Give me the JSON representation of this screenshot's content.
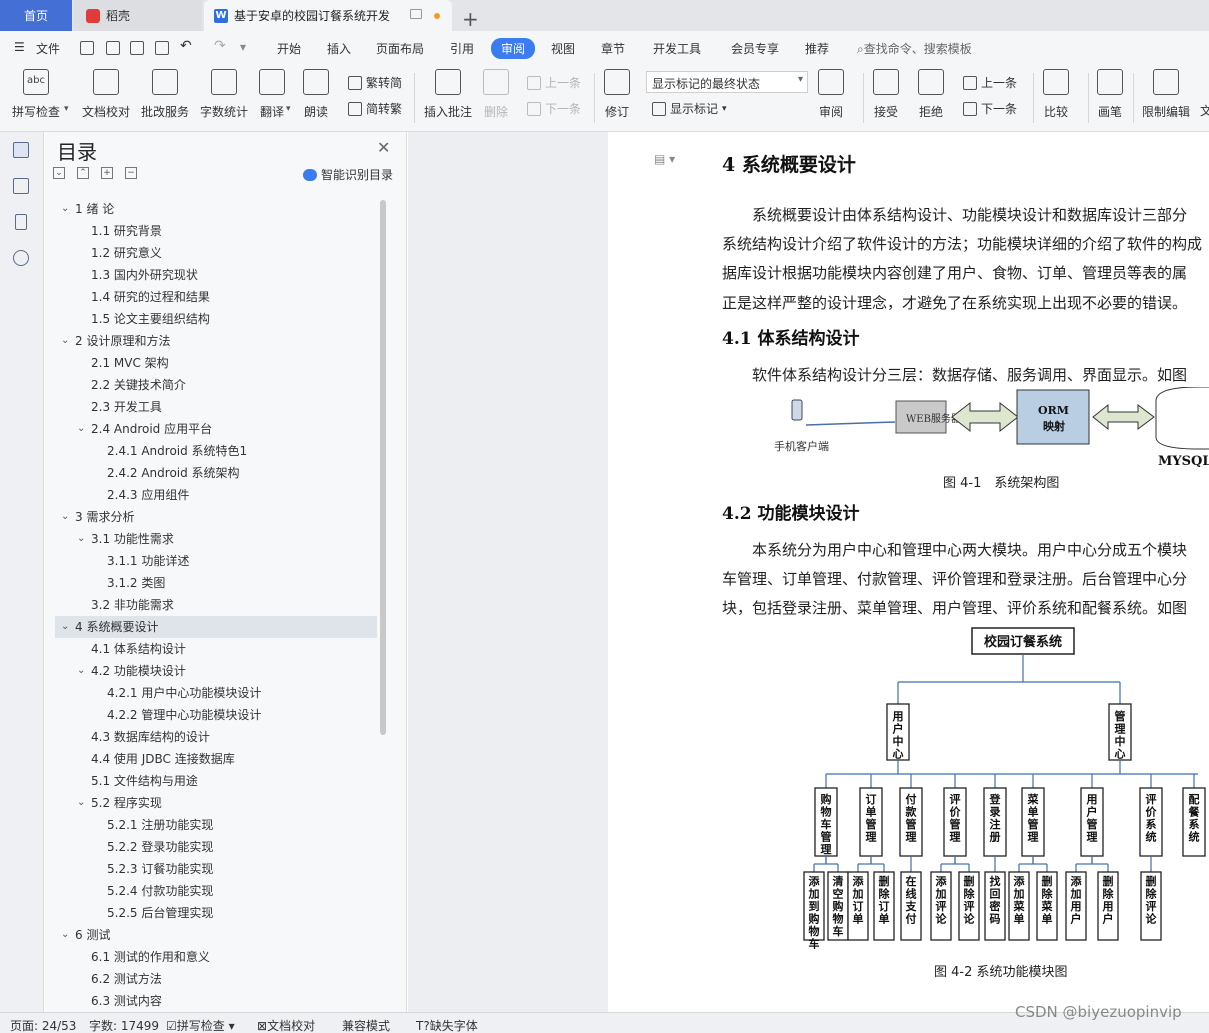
{
  "tabs": {
    "home": "首页",
    "wps": "稻壳",
    "doc": "基于安卓的校园订餐系统开发"
  },
  "menu": {
    "file": "文件",
    "items": [
      "开始",
      "插入",
      "页面布局",
      "引用",
      "审阅",
      "视图",
      "章节",
      "开发工具",
      "会员专享",
      "推荐"
    ],
    "search": "查找命令、搜索模板"
  },
  "ribbon": {
    "spellcheck": "拼写检查",
    "doccheck": "文档校对",
    "batch": "批改服务",
    "wordcount": "字数统计",
    "translate": "翻译",
    "read": "朗读",
    "t2s": "繁转简",
    "s2t": "简转繁",
    "insert_comment": "插入批注",
    "delete": "删除",
    "prev": "上一条",
    "next": "下一条",
    "revise": "修订",
    "state": "显示标记的最终状态",
    "show_marks": "显示标记",
    "review": "审阅",
    "accept": "接受",
    "reject": "拒绝",
    "prev2": "上一条",
    "next2": "下一条",
    "compare": "比较",
    "pen": "画笔",
    "restrict": "限制编辑",
    "doc_char": "文"
  },
  "toc": {
    "title": "目录",
    "smart": "智能识别目录",
    "items": [
      {
        "t": "1  绪  论",
        "l": 1,
        "arrow": "down"
      },
      {
        "t": "1.1  研究背景",
        "l": 2
      },
      {
        "t": "1.2  研究意义",
        "l": 2
      },
      {
        "t": "1.3  国内外研究现状",
        "l": 2
      },
      {
        "t": "1.4  研究的过程和结果",
        "l": 2
      },
      {
        "t": "1.5  论文主要组织结构",
        "l": 2
      },
      {
        "t": "2  设计原理和方法",
        "l": 1,
        "arrow": "down"
      },
      {
        "t": "2.1 MVC 架构",
        "l": 2
      },
      {
        "t": "2.2  关键技术简介",
        "l": 2
      },
      {
        "t": "2.3  开发工具",
        "l": 2
      },
      {
        "t": "2.4 Android 应用平台",
        "l": 2,
        "arrow": "down"
      },
      {
        "t": "2.4.1 Android 系统特色1",
        "l": 3
      },
      {
        "t": "2.4.2 Android 系统架构",
        "l": 3
      },
      {
        "t": "2.4.3  应用组件",
        "l": 3
      },
      {
        "t": "3  需求分析",
        "l": 1,
        "arrow": "down"
      },
      {
        "t": "3.1  功能性需求",
        "l": 2,
        "arrow": "down"
      },
      {
        "t": "3.1.1 功能详述",
        "l": 3
      },
      {
        "t": "3.1.2  类图",
        "l": 3
      },
      {
        "t": "3.2  非功能需求",
        "l": 2
      },
      {
        "t": "4  系统概要设计",
        "l": 1,
        "arrow": "down",
        "sel": true
      },
      {
        "t": "4.1  体系结构设计",
        "l": 2
      },
      {
        "t": "4.2  功能模块设计",
        "l": 2,
        "arrow": "down"
      },
      {
        "t": "4.2.1  用户中心功能模块设计",
        "l": 3
      },
      {
        "t": "4.2.2  管理中心功能模块设计",
        "l": 3
      },
      {
        "t": "4.3  数据库结构的设计",
        "l": 2
      },
      {
        "t": "4.4  使用 JDBC 连接数据库",
        "l": 2
      },
      {
        "t": "5.1 文件结构与用途",
        "l": 2
      },
      {
        "t": "5.2  程序实现",
        "l": 2,
        "arrow": "down"
      },
      {
        "t": "5.2.1  注册功能实现",
        "l": 3
      },
      {
        "t": "5.2.2  登录功能实现",
        "l": 3
      },
      {
        "t": "5.2.3  订餐功能实现",
        "l": 3
      },
      {
        "t": "5.2.4  付款功能实现",
        "l": 3
      },
      {
        "t": "5.2.5  后台管理实现",
        "l": 3
      },
      {
        "t": "6  测试",
        "l": 1,
        "arrow": "down"
      },
      {
        "t": "6.1  测试的作用和意义",
        "l": 2
      },
      {
        "t": "6.2  测试方法",
        "l": 2
      },
      {
        "t": "6.3  测试内容",
        "l": 2
      }
    ]
  },
  "doc": {
    "h4": "4  系统概要设计",
    "p1": [
      "　　系统概要设计由体系结构设计、功能模块设计和数据库设计三部分",
      "系统结构设计介绍了软件设计的方法；功能模块详细的介绍了软件的构成",
      "据库设计根据功能模块内容创建了用户、食物、订单、管理员等表的属",
      "正是这样严整的设计理念，才避免了在系统实现上出现不必要的错误。"
    ],
    "h41": "4.1 体系结构设计",
    "p2": "　　软件体系结构设计分三层：数据存储、服务调用、界面显示。如图",
    "fig1": {
      "client": "手机客户端",
      "server": "WEB服务器",
      "orm1": "ORM",
      "orm2": "映射",
      "db": "MYSQL"
    },
    "cap1": "图 4-1　系统架构图",
    "h42": "4.2 功能模块设计",
    "p3": [
      "　　本系统分为用户中心和管理中心两大模块。用户中心分成五个模块",
      "车管理、订单管理、付款管理、评价管理和登录注册。后台管理中心分",
      "块，包括登录注册、菜单管理、用户管理、评价系统和配餐系统。如图"
    ],
    "fig2": {
      "root": "校园订餐系统",
      "level1": [
        "用户中心",
        "管理中心"
      ],
      "level2": [
        "购物车管理",
        "订单管理",
        "付款管理",
        "评价管理",
        "登录注册",
        "菜单管理",
        "用户管理",
        "评价系统",
        "配餐系统"
      ],
      "level3": [
        "添加到购物车",
        "清空购物车",
        "添加订单",
        "删除订单",
        "在线支付",
        "添加评论",
        "删除评论",
        "找回密码",
        "添加菜单",
        "删除菜单",
        "添加用户",
        "删除用户",
        "删除评论"
      ]
    },
    "cap2": "图 4-2 系统功能模块图"
  },
  "status": {
    "page": "页面: 24/53",
    "words": "字数: 17499",
    "spell": "拼写检查",
    "doccheck": "文档校对",
    "compat": "兼容模式",
    "missing": "缺失字体"
  },
  "watermark": "CSDN @biyezuopinvip"
}
